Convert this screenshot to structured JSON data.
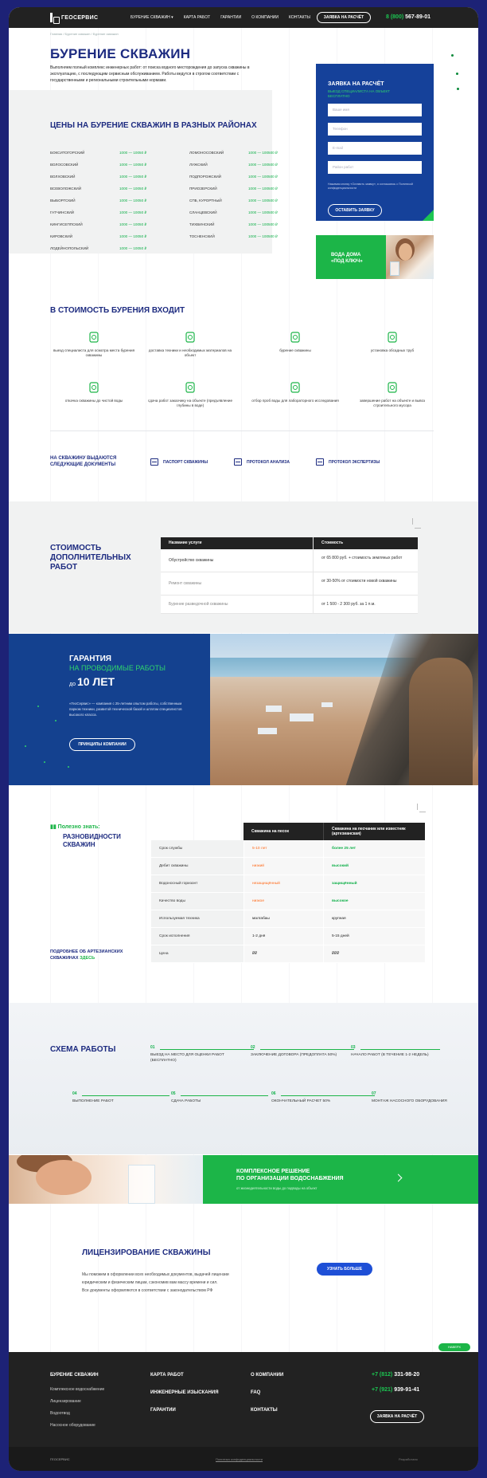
{
  "header": {
    "logo": "ГЕОСЕРВИС",
    "nav": [
      "БУРЕНИЕ СКВАЖИН ▾",
      "КАРТА РАБОТ",
      "ГАРАНТИИ",
      "О КОМПАНИИ",
      "КОНТАКТЫ"
    ],
    "order_button": "ЗАЯВКА НА РАСЧЁТ",
    "phone_code": "8 (800)",
    "phone_num": "567-89-01"
  },
  "breadcrumb": "Главная / Бурение скважин / Бурение скважин",
  "title": "БУРЕНИЕ СКВАЖИН",
  "lead": "Выполняем полный комплекс инженерных работ: от поиска водного месторождения до запуска скважины в эксплуатацию, с последующим сервисным обслуживанием. Работы ведутся в строгом соответствии с государственными и региональными строительными нормами.",
  "prices": {
    "heading": "ЦЕНЫ НА БУРЕНИЕ СКВАЖИН В РАЗНЫХ РАЙОНАХ",
    "left": [
      {
        "d": "БОКСИТОГОРСКИЙ",
        "v": "1000 — 10050 ₽"
      },
      {
        "d": "ВОЛОСОВСКИЙ",
        "v": "1000 — 10050 ₽"
      },
      {
        "d": "ВОЛХОВСКИЙ",
        "v": "1000 — 10050 ₽"
      },
      {
        "d": "ВСЕВОЛОЖСКИЙ",
        "v": "1000 — 10050 ₽"
      },
      {
        "d": "ВЫБОРГСКИЙ",
        "v": "1000 — 10050 ₽"
      },
      {
        "d": "ГАТЧИНСКИЙ",
        "v": "1000 — 10050 ₽"
      },
      {
        "d": "КИНГИСЕППСКИЙ",
        "v": "1000 — 10050 ₽"
      },
      {
        "d": "КИРОВСКИЙ",
        "v": "1000 — 10050 ₽"
      },
      {
        "d": "ЛОДЕЙНОПОЛЬСКИЙ",
        "v": "1000 — 10050 ₽"
      }
    ],
    "right": [
      {
        "d": "ЛОМОНОСОВСКИЙ",
        "v": "1000 — 100500 ₽"
      },
      {
        "d": "ЛУЖСКИЙ",
        "v": "1000 — 100500 ₽"
      },
      {
        "d": "ПОДПОРОЖСКИЙ",
        "v": "1000 — 100500 ₽"
      },
      {
        "d": "ПРИОЗЕРСКИЙ",
        "v": "1000 — 100500 ₽"
      },
      {
        "d": "СПБ, КУРОРТНЫЙ",
        "v": "1000 — 100500 ₽"
      },
      {
        "d": "СЛАНЦЕВСКИЙ",
        "v": "1000 — 100500 ₽"
      },
      {
        "d": "ТИХВИНСКИЙ",
        "v": "1000 — 100500 ₽"
      },
      {
        "d": "ТОСНЕНСКИЙ",
        "v": "1000 — 100500 ₽"
      }
    ]
  },
  "form": {
    "title": "ЗАЯВКА НА РАСЧЁТ",
    "subtitle": "ВЫЕЗД СПЕЦИАЛИСТА НА ОБЪЕКТ БЕСПЛАТНО",
    "fields": [
      "Ваше имя",
      "Телефон",
      "E-mail",
      "Район работ"
    ],
    "note": "Нажимая кнопку «Оставить заявку», я соглашаюсь с Политикой конфиденциальности",
    "button": "ОСТАВИТЬ ЗАЯВКУ"
  },
  "water": {
    "line1": "ВОДА ДОМА",
    "line2": "«ПОД КЛЮЧ»"
  },
  "includes": {
    "heading": "В СТОИМОСТЬ БУРЕНИЯ ВХОДИТ",
    "items": [
      "выезд специалиста для осмотра места бурения скважины",
      "доставка техники и необходимых материалов на объект",
      "бурение скважины",
      "установка обсадных труб",
      "откачка скважины до чистой воды",
      "сдача работ заказчику на объекте (предъявление глубины в воде)",
      "отбор проб воды для лабораторного исследования",
      "завершение работ на объекте и вывоз строительного мусора"
    ]
  },
  "docs": {
    "title": "НА СКВАЖИНУ ВЫДАЮТСЯ СЛЕДУЮЩИЕ ДОКУМЕНТЫ",
    "items": [
      "ПАСПОРТ СКВАЖИНЫ",
      "ПРОТОКОЛ АНАЛИЗА",
      "ПРОТОКОЛ ЭКСПЕРТИЗЫ"
    ]
  },
  "cost": {
    "heading": "СТОИМОСТЬ ДОПОЛНИТЕЛЬНЫХ РАБОТ",
    "col1": "Название услуги",
    "col2": "Стоимость",
    "rows": [
      {
        "s": "Обустройство скважины",
        "p": "от 65 800 руб. + стоимость земляных работ"
      },
      {
        "s": "Ремонт скважины",
        "p": "от 30-50% от стоимости новой скважины"
      },
      {
        "s": "Бурение разведочной скважины",
        "p": "от 1 500 - 2 300 руб. за 1 п.м."
      }
    ]
  },
  "guarantee": {
    "title": "ГАРАНТИЯ",
    "subtitle": "НА ПРОВОДИМЫЕ РАБОТЫ",
    "prefix": "до",
    "years": "10 ЛЕТ",
    "text": "«ГеоСервис» — компания с 25-летним опытом работы, собственным парком техники, развитой технической базой и штатом специалистов высокого класса.",
    "button": "ПРИНЦИПЫ КОМПАНИИ"
  },
  "compare": {
    "tag": "Полезно знать:",
    "title": "РАЗНОВИДНОСТИ СКВАЖИН",
    "more": "ПОДРОБНЕЕ ОБ АРТЕЗИАНСКИХ СКВАЖИНАХ",
    "more_link": "ЗДЕСЬ",
    "col1": "Скважина на песок",
    "col2": "Скважина на песчаник или известняк (артезианская)",
    "rows": [
      {
        "k": "Срок службы",
        "a": "5-10 лет",
        "b": "более 25 лет"
      },
      {
        "k": "Дебит скважины",
        "a": "низкий",
        "b": "высокий"
      },
      {
        "k": "Водоносный горизонт",
        "a": "незащищённый",
        "b": "защищённый"
      },
      {
        "k": "Качество воды",
        "a": "низкое",
        "b": "высокое"
      },
      {
        "k": "Используемая техника",
        "a": "малгабаы",
        "b": "крупная"
      },
      {
        "k": "Срок исполнения",
        "a": "1-2 дня",
        "b": "5-15 дней"
      },
      {
        "k": "Цена",
        "a": "₽₽",
        "b": "₽₽₽"
      }
    ]
  },
  "scheme": {
    "heading": "СХЕМА РАБОТЫ",
    "steps": [
      {
        "n": "01",
        "t": "ВЫЕЗД НА МЕСТО ДЛЯ ОЦЕНКИ РАБОТ (БЕСПЛАТНО)"
      },
      {
        "n": "02",
        "t": "ЗАКЛЮЧЕНИЕ ДОГОВОРА (ПРЕДОПЛАТА 50%)"
      },
      {
        "n": "03",
        "t": "НАЧАЛО РАБОТ (В ТЕЧЕНИЕ 1-2 НЕДЕЛЬ)"
      },
      {
        "n": "04",
        "t": "ВЫПОЛНЕНИЕ РАБОТ"
      },
      {
        "n": "05",
        "t": "СДАЧА РАБОТЫ"
      },
      {
        "n": "06",
        "t": "ОКОНЧАТЕЛЬНЫЙ РАСЧЕТ 50%"
      },
      {
        "n": "07",
        "t": "МОНТАЖ НАСОСНОГО ОБОРУДОВАНИЯ"
      }
    ]
  },
  "solution": {
    "line1": "КОМПЛЕКСНОЕ РЕШЕНИЕ",
    "line2": "ПО ОРГАНИЗАЦИИ ВОДОСНАБЖЕНИЯ",
    "sub": "от жизнедеятельности воды до подводы на объект"
  },
  "license": {
    "heading": "ЛИЦЕНЗИРОВАНИЕ СКВАЖИНЫ",
    "p1": "Мы поможем в оформлении всех необходимых документов, выдачей лицензии",
    "p2": "юридическим и физическим лицам, сэкономив вам массу времени и сил.",
    "p3": "Все документы оформляются в соответствии с законодательством РФ",
    "button": "УЗНАТЬ БОЛЬШЕ",
    "up": "НАВЕРХ"
  },
  "footer": {
    "col1_head": "БУРЕНИЕ СКВАЖИН",
    "col1": [
      "Комплексное водоснабжение",
      "Лицензирование",
      "Водоотвод",
      "Насосное оборудование"
    ],
    "col2": [
      "КАРТА РАБОТ",
      "ИНЖЕНЕРНЫЕ ИЗЫСКАНИЯ",
      "ГАРАНТИИ"
    ],
    "col3": [
      "О КОМПАНИИ",
      "FAQ",
      "КОНТАКТЫ"
    ],
    "phone1_code": "+7 (812)",
    "phone1": "331-98-20",
    "phone2_code": "+7 (921)",
    "phone2": "939-91-41",
    "button": "ЗАЯВКА НА РАСЧЁТ",
    "logo": "ГЕОСЕРВИС",
    "policy": "Политика конфиденциальности",
    "dev": "Разработано"
  },
  "colors": {
    "brand_blue": "#1d2b80",
    "accent_green": "#1cb548",
    "dark": "#222222",
    "form_blue": "#15419a"
  }
}
